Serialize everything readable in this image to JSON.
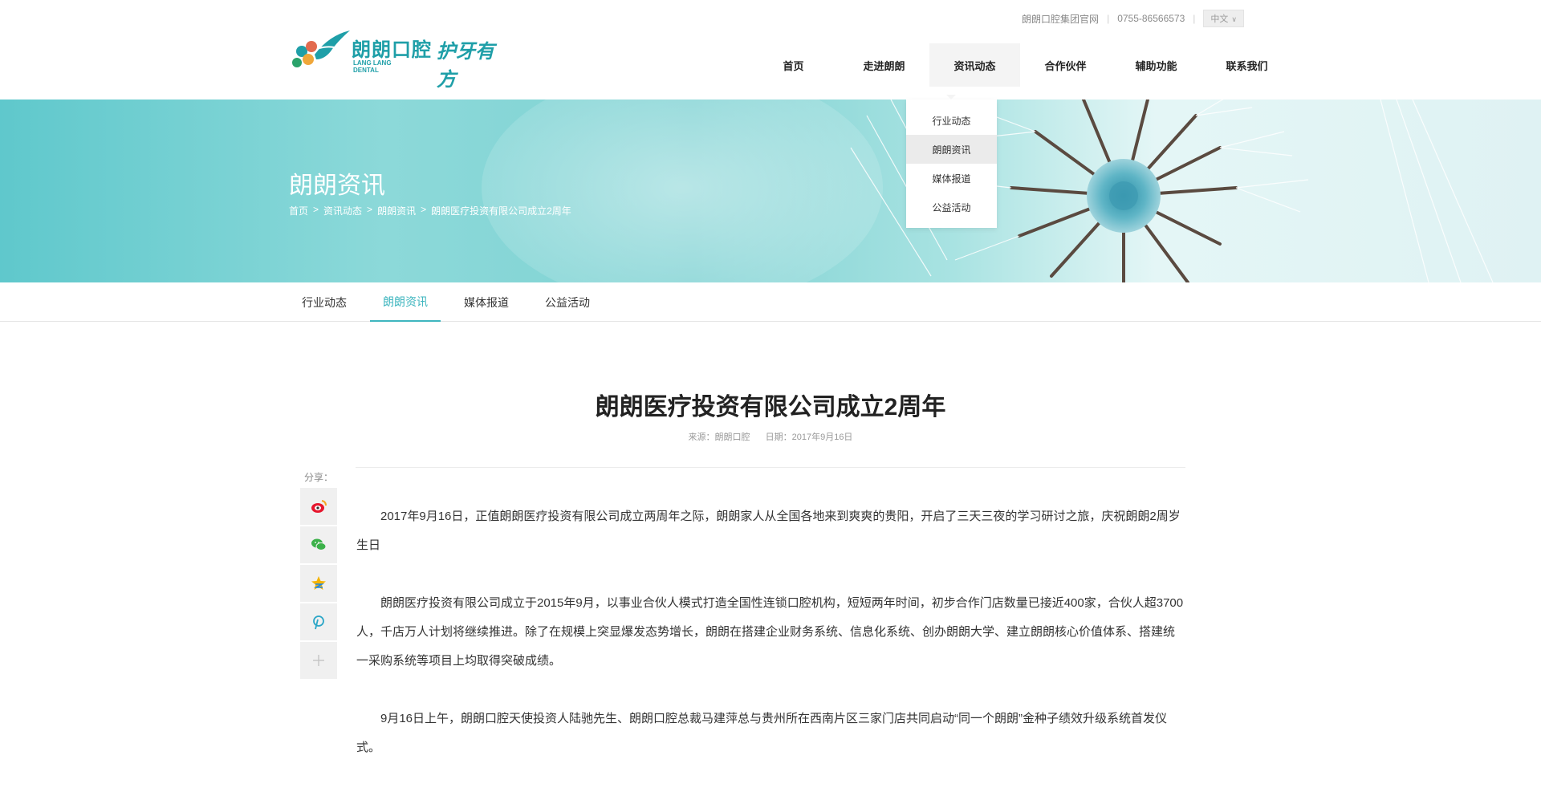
{
  "brand": {
    "wordmark": "朗朗口腔",
    "sub": "LANG LANG DENTAL",
    "slogan": "护牙有方",
    "color_primary": "#1f9fa8",
    "color_accent": "#3fb6bf"
  },
  "topbar": {
    "group_site": "朗朗口腔集团官网",
    "phone": "0755-86566573",
    "language": "中文"
  },
  "nav": {
    "items": [
      {
        "label": "首页"
      },
      {
        "label": "走进朗朗"
      },
      {
        "label": "资讯动态"
      },
      {
        "label": "合作伙伴"
      },
      {
        "label": "辅助功能"
      },
      {
        "label": "联系我们"
      }
    ],
    "active_index": 2
  },
  "dropdown": {
    "items": [
      {
        "label": "行业动态"
      },
      {
        "label": "朗朗资讯"
      },
      {
        "label": "媒体报道"
      },
      {
        "label": "公益活动"
      }
    ],
    "active_index": 1
  },
  "banner": {
    "title": "朗朗资讯",
    "breadcrumbs": [
      "首页",
      "资讯动态",
      "朗朗资讯",
      "朗朗医疗投资有限公司成立2周年"
    ],
    "separator": ">"
  },
  "subtabs": {
    "items": [
      {
        "label": "行业动态"
      },
      {
        "label": "朗朗资讯"
      },
      {
        "label": "媒体报道"
      },
      {
        "label": "公益活动"
      }
    ],
    "active_index": 1
  },
  "article": {
    "title": "朗朗医疗投资有限公司成立2周年",
    "source": "来源：朗朗口腔",
    "date": "日期：2017年9月16日",
    "paragraphs": [
      "2017年9月16日，正值朗朗医疗投资有限公司成立两周年之际，朗朗家人从全国各地来到爽爽的贵阳，开启了三天三夜的学习研讨之旅，庆祝朗朗2周岁生日",
      "朗朗医疗投资有限公司成立于2015年9月，以事业合伙人模式打造全国性连锁口腔机构，短短两年时间，初步合作门店数量已接近400家，合伙人超3700人，千店万人计划将继续推进。除了在规模上突显爆发态势增长，朗朗在搭建企业财务系统、信息化系统、创办朗朗大学、建立朗朗核心价值体系、搭建统一采购系统等项目上均取得突破成绩。",
      "9月16日上午，朗朗口腔天使投资人陆驰先生、朗朗口腔总裁马建萍总与贵州所在西南片区三家门店共同启动“同一个朗朗”金种子绩效升级系统首发仪式。"
    ]
  },
  "share": {
    "label": "分享：",
    "buttons": [
      {
        "icon": "weibo-icon"
      },
      {
        "icon": "wechat-icon"
      },
      {
        "icon": "qzone-icon"
      },
      {
        "icon": "pinterest-icon"
      },
      {
        "icon": "plus-icon"
      }
    ]
  }
}
